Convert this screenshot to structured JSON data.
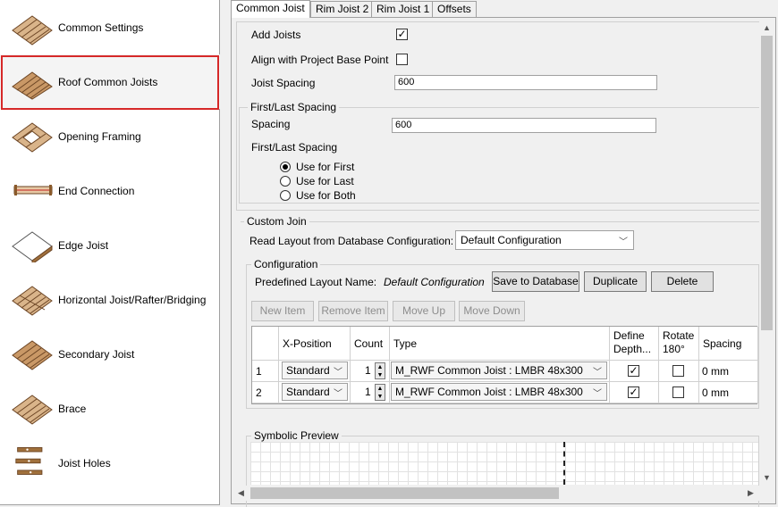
{
  "sidebar": {
    "items": [
      {
        "label": "Common Settings",
        "icon": "common-settings-icon"
      },
      {
        "label": "Roof Common Joists",
        "icon": "roof-joists-icon"
      },
      {
        "label": "Opening Framing",
        "icon": "opening-framing-icon"
      },
      {
        "label": "End Connection",
        "icon": "end-connection-icon"
      },
      {
        "label": "Edge Joist",
        "icon": "edge-joist-icon"
      },
      {
        "label": "Horizontal Joist/Rafter/Bridging",
        "icon": "horizontal-joist-icon"
      },
      {
        "label": "Secondary Joist",
        "icon": "secondary-joist-icon"
      },
      {
        "label": "Brace",
        "icon": "brace-icon"
      },
      {
        "label": "Joist Holes",
        "icon": "joist-holes-icon"
      }
    ],
    "selected": "Roof Common Joists"
  },
  "tabs": [
    "Common Joist",
    "Rim Joist 2",
    "Rim Joist 1",
    "Offsets"
  ],
  "active_tab": "Common Joist",
  "form": {
    "add_joists_label": "Add Joists",
    "add_joists_checked": true,
    "align_label": "Align with Project Base Point",
    "align_checked": false,
    "joist_spacing_label": "Joist Spacing",
    "joist_spacing_value": "600"
  },
  "first_last": {
    "group_title": "First/Last Spacing",
    "spacing_label": "Spacing",
    "spacing_value": "600",
    "sub_label": "First/Last Spacing",
    "options": [
      "Use for First",
      "Use for Last",
      "Use for Both"
    ],
    "selected": "Use for First"
  },
  "custom_join": {
    "group_title": "Custom Join",
    "read_layout_label": "Read Layout from Database Configuration:",
    "read_layout_value": "Default Configuration"
  },
  "configuration": {
    "group_title": "Configuration",
    "predefined_label": "Predefined Layout Name:",
    "predefined_value": "Default Configuration",
    "save_button": "Save to Database",
    "duplicate_button": "Duplicate",
    "delete_button": "Delete",
    "new_item": "New Item",
    "remove_item": "Remove Item",
    "move_up": "Move Up",
    "move_down": "Move Down"
  },
  "grid": {
    "headers": [
      "X-Position",
      "Count",
      "Type",
      "Define Depth...",
      "Rotate 180°",
      "Spacing"
    ],
    "rows": [
      {
        "num": "1",
        "x_position": "Standard",
        "count": "1",
        "type": "M_RWF Common Joist : LMBR 48x300",
        "define_depth": true,
        "rotate": false,
        "spacing": "0 mm"
      },
      {
        "num": "2",
        "x_position": "Standard",
        "count": "1",
        "type": "M_RWF Common Joist : LMBR 48x300",
        "define_depth": true,
        "rotate": false,
        "spacing": "0 mm"
      }
    ]
  },
  "preview": {
    "group_title": "Symbolic Preview"
  },
  "colors": {
    "selection_frame": "#d62828",
    "panel_bg": "#f0f0f0",
    "wood": "#a0703c"
  }
}
